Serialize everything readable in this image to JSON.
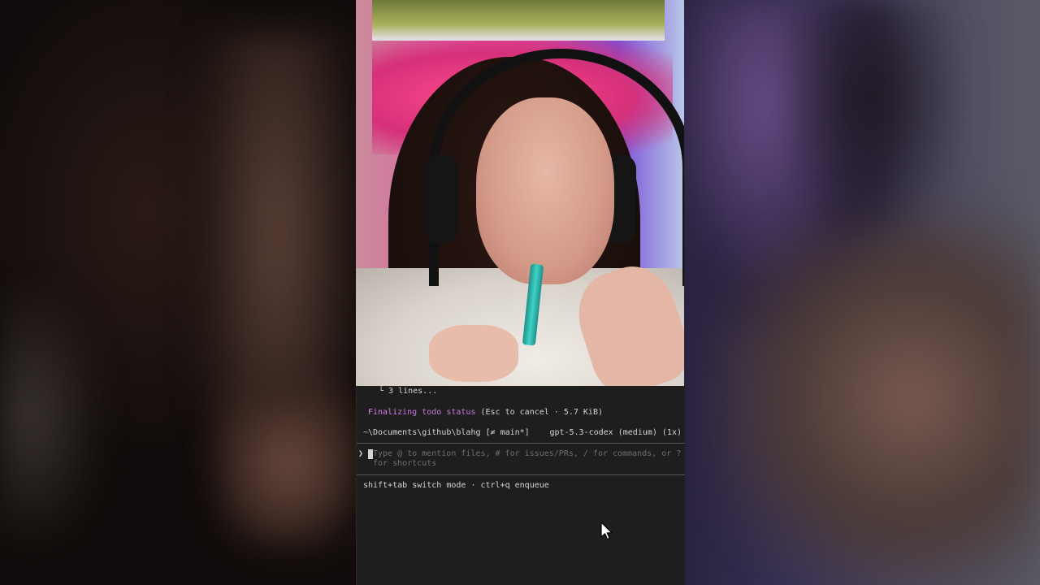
{
  "terminal": {
    "collapsed_output": "└ 3 lines...",
    "status": {
      "activity_part1": "Finali",
      "activity_part2": "zing todo status",
      "detail": "(Esc to cancel · 5.7 KiB)"
    },
    "path": "~\\Documents\\github\\blahg [≠ main*]",
    "model": "gpt-5.3-codex (medium) (1x)",
    "prompt": {
      "arrow": "❯",
      "placeholder": "Type @ to mention files, # for issues/PRs, / for commands, or ? for shortcuts",
      "value": ""
    },
    "shortcuts": "shift+tab switch mode · ctrl+q enqueue"
  },
  "colors": {
    "terminal_bg": "#1e1e1e",
    "accent_magenta": "#c678dd",
    "text": "#d4d4d4",
    "placeholder": "#6e6e6e"
  }
}
